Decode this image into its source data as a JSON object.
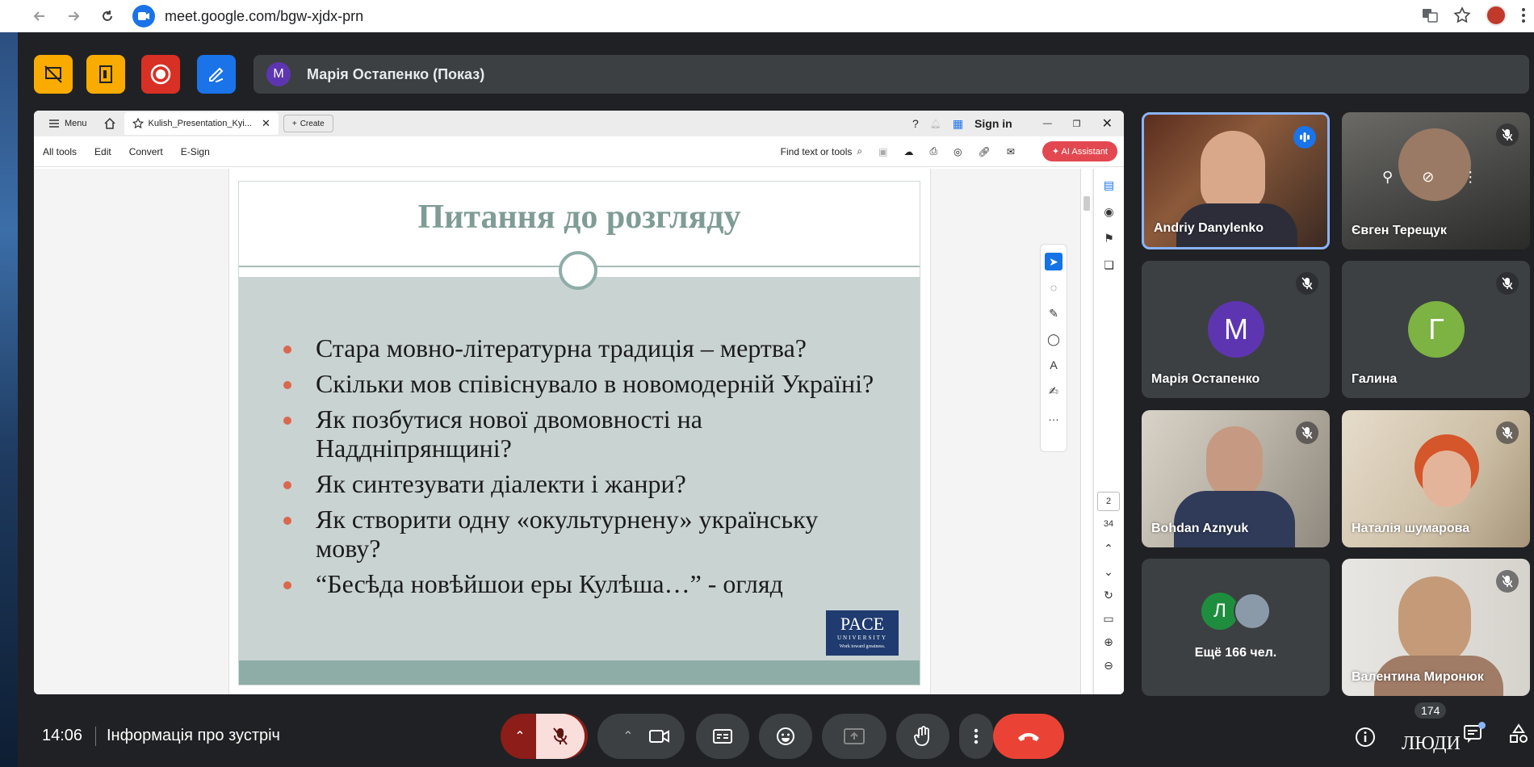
{
  "browser": {
    "url": "meet.google.com/bgw-xjdx-prn"
  },
  "presenter": {
    "avatar_letter": "M",
    "label": "Марія Остапенко (Показ)"
  },
  "acrobat": {
    "menu_label": "Menu",
    "tab_title": "Kulish_Presentation_Kyi...",
    "create_label": "Create",
    "sign_in": "Sign in",
    "toolbar": [
      "All tools",
      "Edit",
      "Convert",
      "E-Sign"
    ],
    "find_label": "Find text or tools",
    "ai_label": "AI Assistant",
    "page_current": "2",
    "page_total": "34"
  },
  "slide": {
    "title": "Питання до розгляду",
    "bullets": [
      "Стара мовно-літературна традиція – мертва?",
      "Скільки мов співіснувало в новомодерній Україні?",
      "Як позбутися нової двомовності на Наддніпрянщині?",
      "Як синтезувати діалекти і жанри?",
      "Як створити одну «окультурнену» українську мову?",
      "“Бесѣда новѣйшои еры Кулѣша…” - огляд"
    ],
    "logo_text": "PACE",
    "logo_sub": "UNIVERSITY",
    "logo_tag": "Work toward greatness."
  },
  "participants": [
    {
      "name": "Andriy Danylenko",
      "type": "video",
      "speaking": true
    },
    {
      "name": "Євген Терещук",
      "type": "video",
      "muted": true
    },
    {
      "name": "Марія Остапенко",
      "type": "avatar",
      "letter": "M",
      "color": "#5e35b1",
      "muted": true
    },
    {
      "name": "Галина",
      "type": "avatar",
      "letter": "Г",
      "color": "#7cb342",
      "muted": true
    },
    {
      "name": "Bohdan Aznyuk",
      "type": "video",
      "muted": true
    },
    {
      "name": "Наталія шумарова",
      "type": "video",
      "muted": true
    },
    {
      "name": "Ещё 166 чел.",
      "type": "more",
      "letter": "Л"
    },
    {
      "name": "Валентина Миронюк",
      "type": "video",
      "muted": true
    }
  ],
  "bottom": {
    "time": "14:06",
    "meeting_info": "Інформація про зустріч",
    "people_count": "174",
    "people_label": "ЛЮДИ"
  },
  "colors": {
    "end_call": "#ea4335",
    "mic_off": "#f9dedc",
    "presenting_tools_yellow": "#f9ab00",
    "record_red": "#d93025",
    "draw_blue": "#1a73e8"
  }
}
